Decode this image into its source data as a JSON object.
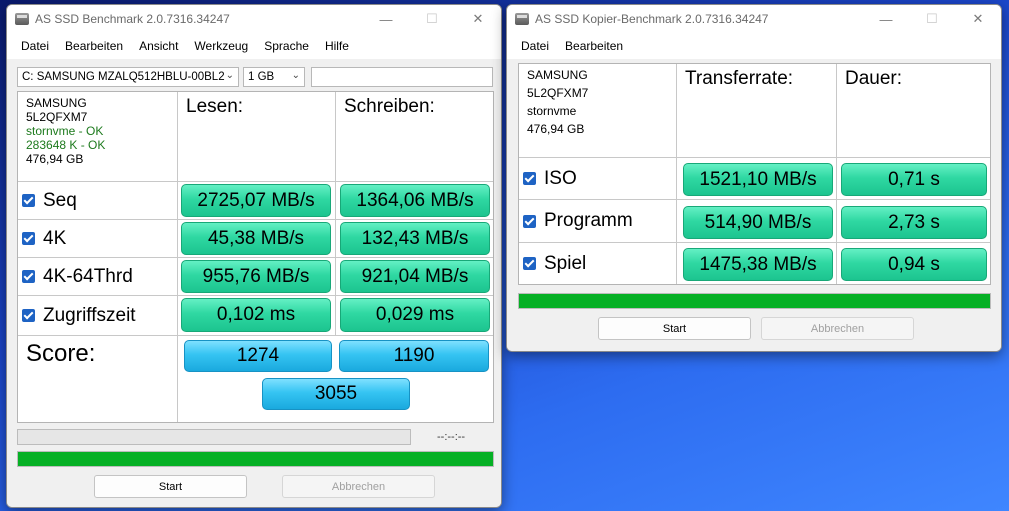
{
  "window1": {
    "title": "AS SSD Benchmark 2.0.7316.34247",
    "menu": [
      "Datei",
      "Bearbeiten",
      "Ansicht",
      "Werkzeug",
      "Sprache",
      "Hilfe"
    ],
    "drive_select": "C: SAMSUNG MZALQ512HBLU-00BL2",
    "size_select": "1 GB",
    "info": {
      "model": "SAMSUNG",
      "firmware": "5L2QFXM7",
      "driver": "stornvme - OK",
      "alignment": "283648 K - OK",
      "capacity": "476,94 GB"
    },
    "headers": {
      "read": "Lesen:",
      "write": "Schreiben:"
    },
    "rows": [
      {
        "label": "Seq",
        "read": "2725,07 MB/s",
        "write": "1364,06 MB/s"
      },
      {
        "label": "4K",
        "read": "45,38 MB/s",
        "write": "132,43 MB/s"
      },
      {
        "label": "4K-64Thrd",
        "read": "955,76 MB/s",
        "write": "921,04 MB/s"
      },
      {
        "label": "Zugriffszeit",
        "read": "0,102 ms",
        "write": "0,029 ms"
      }
    ],
    "score": {
      "label": "Score:",
      "read": "1274",
      "write": "1190",
      "total": "3055"
    },
    "time_display": "--:--:--",
    "progress": 1.0,
    "buttons": {
      "start": "Start",
      "abort": "Abbrechen"
    }
  },
  "window2": {
    "title": "AS SSD Kopier-Benchmark 2.0.7316.34247",
    "menu": [
      "Datei",
      "Bearbeiten"
    ],
    "info": {
      "model": "SAMSUNG",
      "firmware": "5L2QFXM7",
      "driver": "stornvme",
      "capacity": "476,94 GB"
    },
    "headers": {
      "rate": "Transferrate:",
      "duration": "Dauer:"
    },
    "rows": [
      {
        "label": "ISO",
        "rate": "1521,10 MB/s",
        "duration": "0,71 s"
      },
      {
        "label": "Programm",
        "rate": "514,90 MB/s",
        "duration": "2,73 s"
      },
      {
        "label": "Spiel",
        "rate": "1475,38 MB/s",
        "duration": "0,94 s"
      }
    ],
    "progress": 1.0,
    "buttons": {
      "start": "Start",
      "abort": "Abbrechen"
    }
  },
  "colors": {
    "result_green": "#2fd8a2",
    "score_blue": "#35c4f2",
    "progress_green": "#06b025",
    "ok_text": "#1d7a1d"
  }
}
